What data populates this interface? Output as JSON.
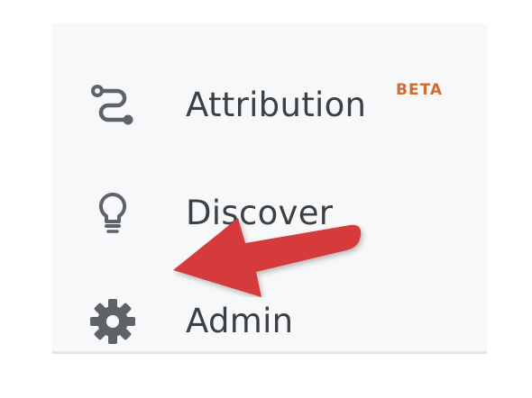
{
  "nav": {
    "items": [
      {
        "label": "Attribution",
        "badge": "BETA",
        "icon": "attribution-route-icon"
      },
      {
        "label": "Discover",
        "icon": "lightbulb-icon"
      },
      {
        "label": "Admin",
        "icon": "gear-icon"
      }
    ]
  },
  "colors": {
    "panel_background": "#f7f8fa",
    "label_text": "#3c4043",
    "icon": "#5f6368",
    "beta_badge": "#d46a2f",
    "annotation_arrow": "#d63b3b"
  },
  "annotation": {
    "icon": "red-arrow-pointing-left"
  }
}
